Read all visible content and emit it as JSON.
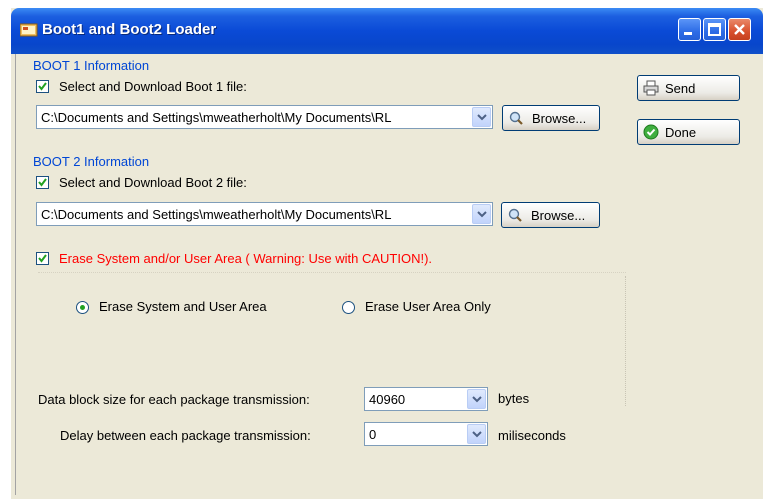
{
  "window": {
    "title": "Boot1 and Boot2 Loader",
    "controls": [
      "minimize-icon",
      "maximize-icon",
      "close-icon"
    ]
  },
  "boot1": {
    "group_label": "BOOT 1 Information",
    "checkbox_label": "Select and Download Boot 1 file:",
    "checked": true,
    "path": "C:\\Documents and Settings\\mweatherholt\\My Documents\\RL",
    "browse_label": "Browse..."
  },
  "boot2": {
    "group_label": "BOOT 2 Information",
    "checkbox_label": "Select and Download Boot 2 file:",
    "checked": true,
    "path": "C:\\Documents and Settings\\mweatherholt\\My Documents\\RL",
    "browse_label": "Browse..."
  },
  "erase": {
    "checkbox_label": "Erase System and/or User Area ( Warning: Use with CAUTION!).",
    "checked": true,
    "warning_color": "#ff0000",
    "options": [
      {
        "label": "Erase System and User Area",
        "selected": true
      },
      {
        "label": "Erase User Area Only",
        "selected": false
      }
    ]
  },
  "transmission": {
    "block_size_label": "Data block size for each package transmission:",
    "block_size_value": "40960",
    "block_size_unit": "bytes",
    "delay_label": "Delay between each package transmission:",
    "delay_value": "0",
    "delay_unit": "miliseconds"
  },
  "actions": {
    "send_label": "Send",
    "done_label": "Done"
  },
  "colors": {
    "titlebar": "#0a4ad6",
    "group_label": "#0046d5",
    "dialog_bg": "#ece9d8"
  }
}
